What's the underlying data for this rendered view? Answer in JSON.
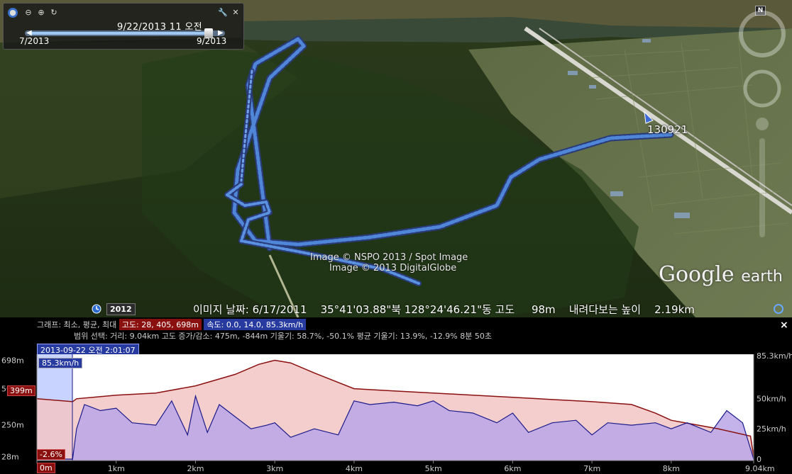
{
  "toolbar": {
    "icons": [
      "globe-icon",
      "zoom-out-icon",
      "zoom-in-icon",
      "refresh-icon"
    ],
    "tools_icon": "wrench-icon",
    "close_icon": "close-icon"
  },
  "time_slider": {
    "current": "9/22/2013  11 오전",
    "start": "7/2013",
    "end": "9/2013",
    "position": 0.93
  },
  "map": {
    "track_label": "130921",
    "copyright_1": "Image © NSPO 2013 / Spot Image",
    "copyright_2": "Image © 2013 DigitalGlobe",
    "logo_word1": "Google",
    "logo_word2": "earth",
    "north": "N",
    "year_badge": "2012",
    "status_line": "이미지 날짜: 6/17/2011    35°41'03.88\"북 128°24'46.21\"동 고도     98m    내려다보는 높이    2.19km"
  },
  "profile": {
    "close": "×",
    "graph_label": "그래프: 최소, 평균, 최대",
    "altitude_chip": "고도: 28, 405, 698m",
    "speed_chip": "속도: 0.0, 14.0, 85.3km/h",
    "range_stats": "범위 선택: 거리: 9.04km  고도 증가/감소: 475m, -844m  기울기: 58.7%, -50.1%  평균 기울기: 13.9%, -12.9%  8분 50초",
    "timestamp": "2013-09-22 오전 2:01:07",
    "speed_readout": "85.3km/h",
    "elevation_readout": "399m",
    "grade_readout": "-2.6%",
    "colors": {
      "elevation_line": "#8b1010",
      "elevation_fill": "#f2c4c4",
      "speed_line": "#1a1a8a",
      "speed_fill": "#b8a6e6",
      "selection": "#c8d4ff"
    }
  },
  "chart_data": {
    "type": "area",
    "xlabel": "",
    "x_ticks": [
      "0m",
      "1km",
      "2km",
      "3km",
      "4km",
      "5km",
      "6km",
      "7km",
      "8km",
      "9.04km"
    ],
    "x_range": [
      0,
      9.04
    ],
    "left_axis_ticks": [
      "698m",
      "500m",
      "250m",
      "28m"
    ],
    "right_axis_ticks": [
      "85.3km/h",
      "50km/h",
      "25km/h",
      "0"
    ],
    "series": [
      {
        "name": "고도",
        "unit": "m",
        "x": [
          0,
          0.45,
          0.5,
          1,
          1.5,
          2,
          2.5,
          2.8,
          3,
          3.2,
          3.5,
          4,
          4.5,
          5,
          5.5,
          6,
          6.5,
          7,
          7.5,
          7.8,
          8,
          8.3,
          8.6,
          9,
          9.04
        ],
        "values": [
          430,
          410,
          430,
          455,
          470,
          520,
          600,
          670,
          698,
          680,
          610,
          500,
          485,
          470,
          455,
          440,
          425,
          410,
          390,
          330,
          280,
          250,
          220,
          170,
          28
        ]
      },
      {
        "name": "속도",
        "unit": "km/h",
        "x": [
          0,
          0.45,
          0.5,
          0.6,
          0.8,
          1,
          1.2,
          1.5,
          1.7,
          1.9,
          2,
          2.15,
          2.3,
          2.5,
          2.7,
          2.9,
          3,
          3.2,
          3.5,
          3.8,
          4,
          4.2,
          4.5,
          4.8,
          5,
          5.2,
          5.5,
          5.8,
          6,
          6.2,
          6.5,
          6.8,
          7,
          7.2,
          7.5,
          7.8,
          8,
          8.2,
          8.5,
          8.7,
          8.9,
          9.04
        ],
        "values": [
          0,
          0,
          25,
          45,
          40,
          42,
          30,
          28,
          48,
          20,
          52,
          22,
          45,
          35,
          25,
          28,
          30,
          18,
          25,
          20,
          48,
          45,
          47,
          44,
          48,
          40,
          38,
          30,
          38,
          22,
          30,
          32,
          20,
          30,
          28,
          30,
          25,
          30,
          22,
          40,
          30,
          0
        ]
      }
    ],
    "legend": "none",
    "grid": false
  }
}
